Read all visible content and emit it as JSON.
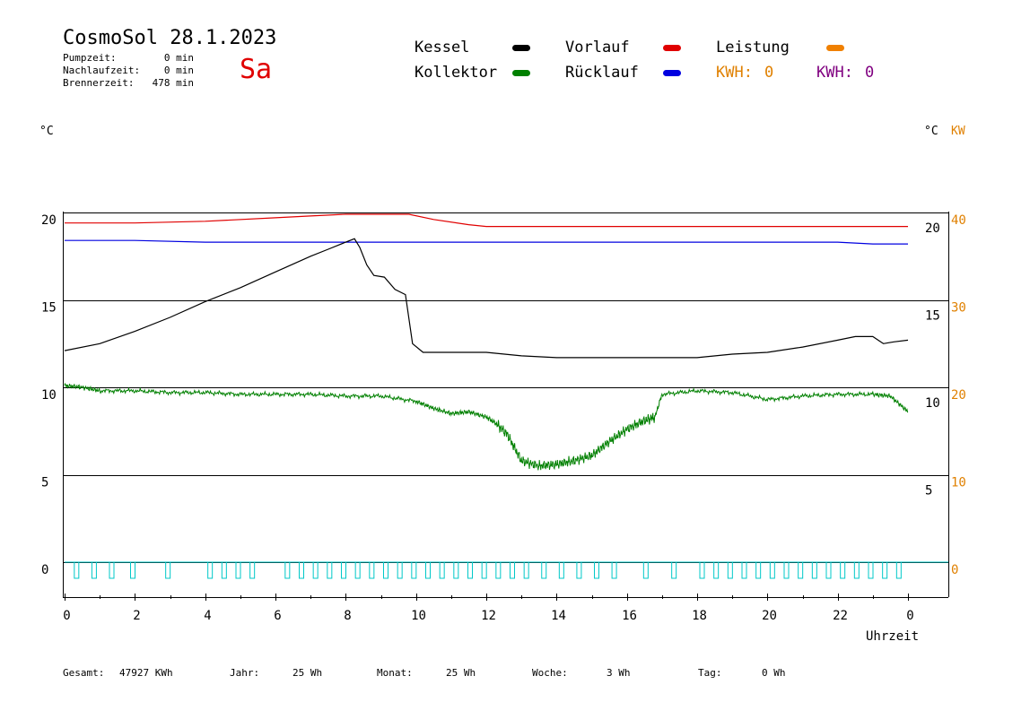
{
  "header": {
    "title": "CosmoSol 28.1.2023",
    "weekday": "Sa",
    "stats": [
      {
        "label": "Pumpzeit:",
        "value": "0 min"
      },
      {
        "label": "Nachlaufzeit:",
        "value": "0 min"
      },
      {
        "label": "Brennerzeit:",
        "value": "478 min"
      }
    ]
  },
  "legend": {
    "kessel": {
      "label": "Kessel",
      "color": "#000000"
    },
    "kollektor": {
      "label": "Kollektor",
      "color": "#008000"
    },
    "vorlauf": {
      "label": "Vorlauf",
      "color": "#e00000"
    },
    "ruecklauf": {
      "label": "Rücklauf",
      "color": "#0000e0"
    },
    "leistung": {
      "label": "Leistung",
      "color": "#f08000"
    },
    "kwh_orange": {
      "label": "KWH:",
      "value": "0",
      "color": "#e08000"
    },
    "kwh_purple": {
      "label": "KWH:",
      "value": "0",
      "color": "#800080"
    }
  },
  "axes": {
    "left_unit": "°C",
    "right_unit": "°C",
    "right_unit2": "KW",
    "xlabel": "Uhrzeit"
  },
  "footer": {
    "gesamt": {
      "label": "Gesamt:",
      "value": "47927 KWh"
    },
    "jahr": {
      "label": "Jahr:",
      "value": "25 Wh"
    },
    "monat": {
      "label": "Monat:",
      "value": "25 Wh"
    },
    "woche": {
      "label": "Woche:",
      "value": "3 Wh"
    },
    "tag": {
      "label": "Tag:",
      "value": "0 Wh"
    }
  },
  "chart_data": {
    "type": "line",
    "xlabel": "Uhrzeit",
    "ylabel": "°C",
    "x_ticks": [
      "0",
      "2",
      "4",
      "6",
      "8",
      "10",
      "12",
      "14",
      "16",
      "18",
      "20",
      "22",
      "0"
    ],
    "y_left_ticks": [
      0,
      5,
      10,
      15,
      20
    ],
    "y_right_ticks": [
      5,
      10,
      15,
      20
    ],
    "y_right2_ticks": [
      0,
      10,
      20,
      30,
      40
    ],
    "xlim": [
      0,
      24
    ],
    "ylim": [
      0,
      20
    ],
    "grid": true,
    "series": [
      {
        "name": "Vorlauf",
        "color": "#e00000",
        "x": [
          0,
          2,
          4,
          6,
          7,
          8,
          9,
          9.8,
          10.5,
          11.5,
          12,
          14,
          16,
          18,
          20,
          22,
          23,
          24
        ],
        "y": [
          19.4,
          19.4,
          19.5,
          19.7,
          19.8,
          19.9,
          19.9,
          19.9,
          19.6,
          19.3,
          19.2,
          19.2,
          19.2,
          19.2,
          19.2,
          19.2,
          19.2,
          19.2
        ]
      },
      {
        "name": "Rücklauf",
        "color": "#0000e0",
        "x": [
          0,
          2,
          4,
          6,
          8,
          10,
          12,
          14,
          16,
          18,
          20,
          22,
          23,
          24
        ],
        "y": [
          18.4,
          18.4,
          18.3,
          18.3,
          18.3,
          18.3,
          18.3,
          18.3,
          18.3,
          18.3,
          18.3,
          18.3,
          18.2,
          18.2
        ]
      },
      {
        "name": "Kessel",
        "color": "#000000",
        "x": [
          0,
          1,
          2,
          3,
          4,
          5,
          6,
          7,
          7.5,
          8,
          8.25,
          8.4,
          8.6,
          8.8,
          9.1,
          9.4,
          9.7,
          9.9,
          10.2,
          11,
          12,
          13,
          14,
          15,
          16,
          17,
          18,
          19,
          20,
          21,
          22,
          22.5,
          23,
          23.3,
          23.6,
          24
        ],
        "y": [
          12.1,
          12.5,
          13.2,
          14.0,
          14.9,
          15.7,
          16.6,
          17.5,
          17.9,
          18.3,
          18.5,
          18.0,
          17.0,
          16.4,
          16.3,
          15.6,
          15.3,
          12.5,
          12.0,
          12.0,
          12.0,
          11.8,
          11.7,
          11.7,
          11.7,
          11.7,
          11.7,
          11.9,
          12.0,
          12.3,
          12.7,
          12.9,
          12.9,
          12.5,
          12.6,
          12.7
        ]
      },
      {
        "name": "Kollektor",
        "color": "#008000",
        "x": [
          0,
          0.5,
          1,
          2,
          3,
          4,
          5,
          6,
          7,
          8,
          9,
          10,
          10.5,
          11,
          11.5,
          12,
          12.3,
          12.6,
          13,
          13.5,
          14,
          14.5,
          15,
          15.5,
          16,
          16.5,
          16.8,
          17,
          18,
          19,
          20,
          21,
          22,
          23,
          23.5,
          24
        ],
        "y": [
          10.1,
          10.0,
          9.8,
          9.8,
          9.7,
          9.7,
          9.6,
          9.6,
          9.6,
          9.5,
          9.5,
          9.2,
          8.8,
          8.5,
          8.6,
          8.3,
          7.9,
          7.3,
          5.8,
          5.5,
          5.6,
          5.8,
          6.1,
          6.9,
          7.6,
          8.1,
          8.3,
          9.6,
          9.8,
          9.7,
          9.3,
          9.5,
          9.6,
          9.6,
          9.5,
          8.6
        ]
      },
      {
        "name": "Leistung",
        "color": "#00c8c8",
        "x": [
          0,
          24
        ],
        "y": [
          0,
          0
        ]
      }
    ]
  }
}
